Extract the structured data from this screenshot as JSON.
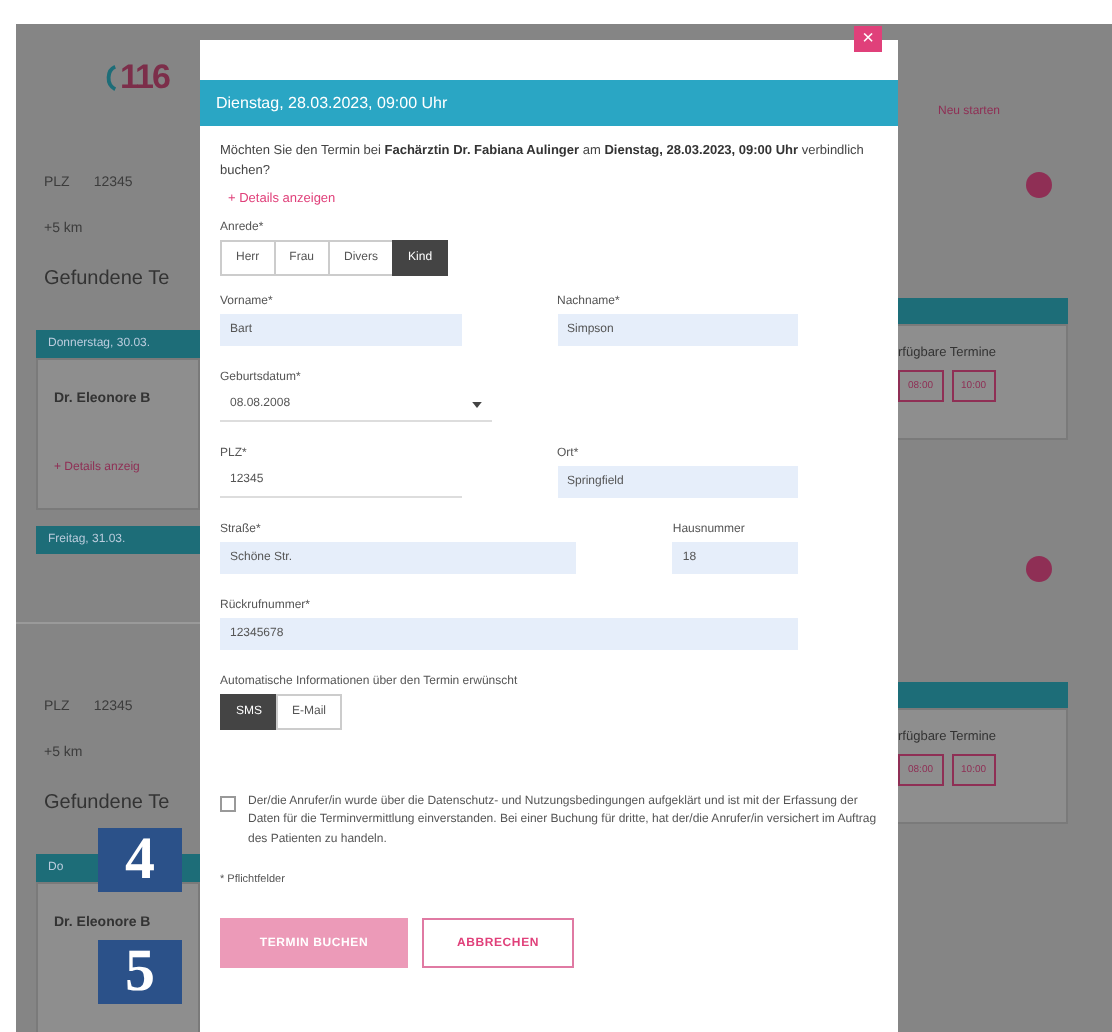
{
  "background": {
    "left": {
      "logo": "116",
      "panels": [
        {
          "plz_label": "PLZ",
          "plz_value": "12345",
          "radius": "+5 km",
          "heading": "Gefundene Te",
          "card_header": "Donnerstag, 30.03.",
          "doctor": "Dr. Eleonore B",
          "details": "+ Details anzeig",
          "next_header": "Freitag, 31.03."
        },
        {
          "plz_label": "PLZ",
          "plz_value": "12345",
          "radius": "+5 km",
          "heading": "Gefundene Te",
          "card_header": "Do",
          "doctor": "Dr. Eleonore B"
        }
      ]
    },
    "right": {
      "link": "Neu starten",
      "panels": [
        {
          "card_title": "rfügbare Termine",
          "times": [
            "08:00",
            "10:00"
          ]
        },
        {
          "card_title": "rfügbare Termine",
          "times": [
            "08:00",
            "10:00"
          ]
        }
      ]
    }
  },
  "dialog": {
    "close": "×",
    "title": "Dienstag, 28.03.2023, 09:00 Uhr",
    "question": "Möchten Sie den Termin bei **Fachärztin Dr. Fabiana Aulinger** am **Dienstag, 28.03.2023, 09:00 Uhr** verbindlich buchen?",
    "details_link": "+ Details anzeigen",
    "salutation": {
      "label": "Anrede*",
      "options": [
        {
          "label": "Herr",
          "selected": false
        },
        {
          "label": "Frau",
          "selected": false
        },
        {
          "label": "Divers",
          "selected": false
        },
        {
          "label": "Kind",
          "selected": true
        }
      ]
    },
    "rows": [
      [
        {
          "label": "Vorname*",
          "value": "Bart",
          "kind": "filled"
        },
        {
          "label": "Nachname*",
          "value": "Simpson",
          "kind": "filled"
        }
      ],
      [
        {
          "label": "Geburtsdatum*",
          "value": "08.08.2008",
          "kind": "select"
        }
      ],
      [
        {
          "label": "PLZ*",
          "value": "12345",
          "kind": "plain"
        },
        {
          "label": "Ort*",
          "value": "Springfield",
          "kind": "filled"
        }
      ],
      [
        {
          "label": "Straße*",
          "value": "Schöne Str.",
          "kind": "filled"
        },
        {
          "label": "Hausnummer",
          "value": "18",
          "kind": "filled"
        }
      ],
      [
        {
          "label": "Rückrufnummer*",
          "value": "12345678",
          "kind": "filled"
        }
      ]
    ],
    "notify": {
      "label": "Automatische Informationen über den Termin erwünscht",
      "options": [
        {
          "label": "SMS",
          "selected": true
        },
        {
          "label": "E-Mail",
          "selected": false
        }
      ]
    },
    "consent": {
      "checked": false,
      "text": "Der/die Anrufer/in wurde über die Datenschutz- und Nutzungsbedingungen aufgeklärt und ist mit der Erfassung der Daten für die Terminvermittlung einverstanden. Bei einer Buchung für dritte, hat der/die Anrufer/in versichert im Auftrag des Patienten zu handeln."
    },
    "required_note": "* Pflichtfelder",
    "buttons": [
      {
        "label": "TERMIN BUCHEN",
        "kind": "primary",
        "disabled": true
      },
      {
        "label": "ABBRECHEN",
        "kind": "secondary",
        "disabled": false
      }
    ]
  },
  "callouts": [
    "4",
    "5"
  ]
}
